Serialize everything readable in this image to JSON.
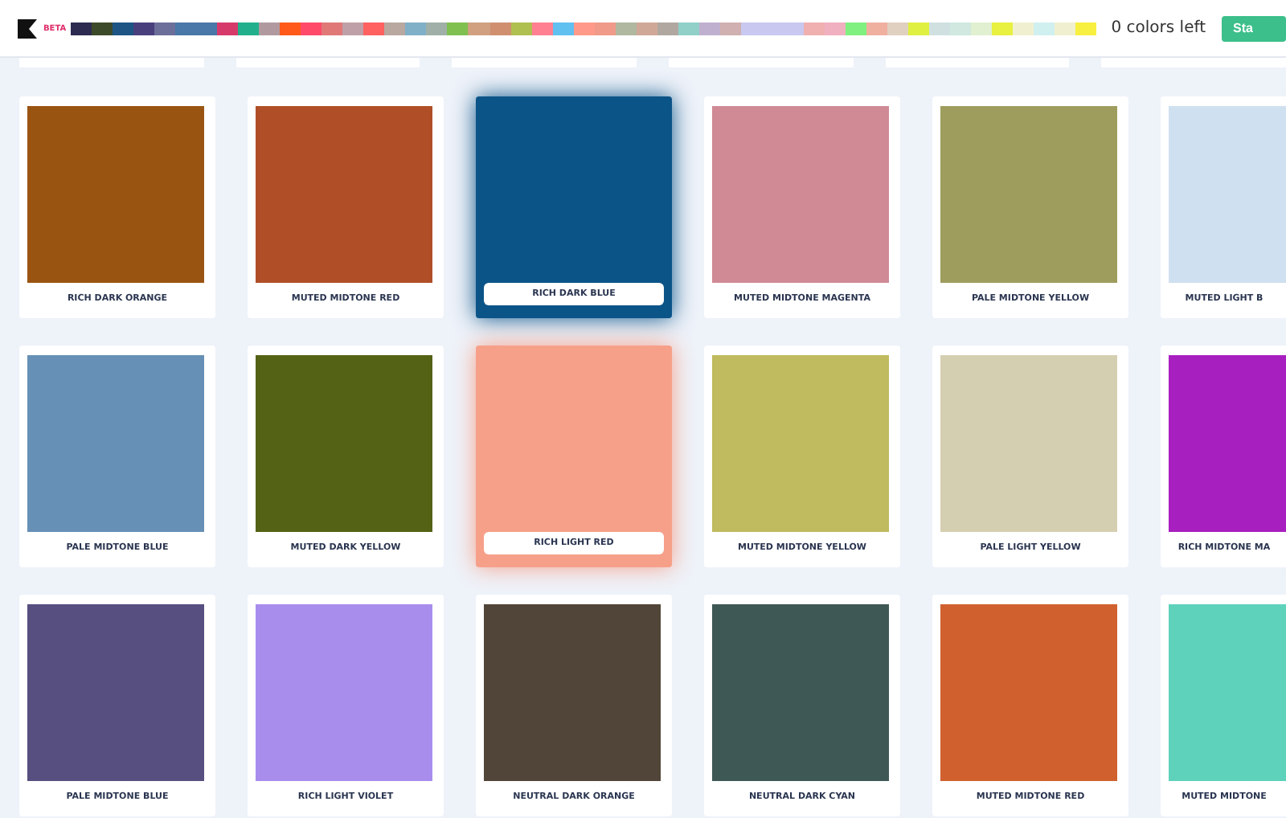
{
  "header": {
    "badge": "BETA",
    "palette": [
      {
        "color": "#2d2b4f"
      },
      {
        "color": "#3d4a2a"
      },
      {
        "color": "#1e5585"
      },
      {
        "color": "#4a3f7d"
      },
      {
        "color": "#6c6f99"
      },
      {
        "color": "#4a78a8"
      },
      {
        "color": "#4a78a8"
      },
      {
        "color": "#d63a6b"
      },
      {
        "color": "#22b08c"
      },
      {
        "color": "#b09aa0"
      },
      {
        "color": "#ff5a1a"
      },
      {
        "color": "#ff4a6a"
      },
      {
        "color": "#e07878"
      },
      {
        "color": "#c0a0a8"
      },
      {
        "color": "#ff6060"
      },
      {
        "color": "#b8a8a0"
      },
      {
        "color": "#80b0c8"
      },
      {
        "color": "#a0b0a8"
      },
      {
        "color": "#80c050"
      },
      {
        "color": "#d0a080"
      },
      {
        "color": "#d09070"
      },
      {
        "color": "#b0c050"
      },
      {
        "color": "#ff8090"
      },
      {
        "color": "#60c0f0"
      },
      {
        "color": "#ff9a8a"
      },
      {
        "color": "#f09a8a"
      },
      {
        "color": "#b0b8a0"
      },
      {
        "color": "#d0a898"
      },
      {
        "color": "#b0a8a0"
      },
      {
        "color": "#90d0c8"
      },
      {
        "color": "#c0b0d0"
      },
      {
        "color": "#d0b0b0"
      },
      {
        "color": "#c8c8f0"
      },
      {
        "color": "#c8c8f0"
      },
      {
        "color": "#c8c8f0"
      },
      {
        "color": "#f0b0b0"
      },
      {
        "color": "#f0b0c0"
      },
      {
        "color": "#80f080"
      },
      {
        "color": "#f0b0a0"
      },
      {
        "color": "#e0d0c0"
      },
      {
        "color": "#e0f040"
      },
      {
        "color": "#d0e0e0"
      },
      {
        "color": "#d0e8e0"
      },
      {
        "color": "#e0f0d0"
      },
      {
        "color": "#e8f040"
      },
      {
        "color": "#f0f0d0"
      },
      {
        "color": "#d0f0f0"
      },
      {
        "color": "#f0f0d0"
      },
      {
        "color": "#f8f040"
      }
    ],
    "counter": "0 colors left",
    "button": "Sta"
  },
  "rows": [
    [
      {
        "name": "RICH DARK ORANGE",
        "color": "#9a5412",
        "selected": false
      },
      {
        "name": "MUTED MIDTONE RED",
        "color": "#b04f27",
        "selected": false
      },
      {
        "name": "RICH DARK BLUE",
        "color": "#0b5488",
        "selected": true
      },
      {
        "name": "MUTED MIDTONE MAGENTA",
        "color": "#cf8a96",
        "selected": false
      },
      {
        "name": "PALE MIDTONE YELLOW",
        "color": "#9e9d5e",
        "selected": false
      },
      {
        "name": "MUTED LIGHT B",
        "color": "#cfe0f0",
        "selected": false
      }
    ],
    [
      {
        "name": "PALE MIDTONE BLUE",
        "color": "#6690b5",
        "selected": false
      },
      {
        "name": "MUTED DARK YELLOW",
        "color": "#546215",
        "selected": false
      },
      {
        "name": "RICH LIGHT RED",
        "color": "#f6a08a",
        "selected": true
      },
      {
        "name": "MUTED MIDTONE YELLOW",
        "color": "#bfbb5e",
        "selected": false
      },
      {
        "name": "PALE LIGHT YELLOW",
        "color": "#d5cfb1",
        "selected": false
      },
      {
        "name": "RICH MIDTONE MA",
        "color": "#a81fc0",
        "selected": false
      }
    ],
    [
      {
        "name": "PALE MIDTONE BLUE",
        "color": "#564f80",
        "selected": false
      },
      {
        "name": "RICH LIGHT VIOLET",
        "color": "#a98ded",
        "selected": false
      },
      {
        "name": "NEUTRAL DARK ORANGE",
        "color": "#504538",
        "selected": false
      },
      {
        "name": "NEUTRAL DARK CYAN",
        "color": "#3e5855",
        "selected": false
      },
      {
        "name": "MUTED MIDTONE RED",
        "color": "#d0612f",
        "selected": false
      },
      {
        "name": "MUTED MIDTONE",
        "color": "#5ed2bb",
        "selected": false
      }
    ]
  ]
}
